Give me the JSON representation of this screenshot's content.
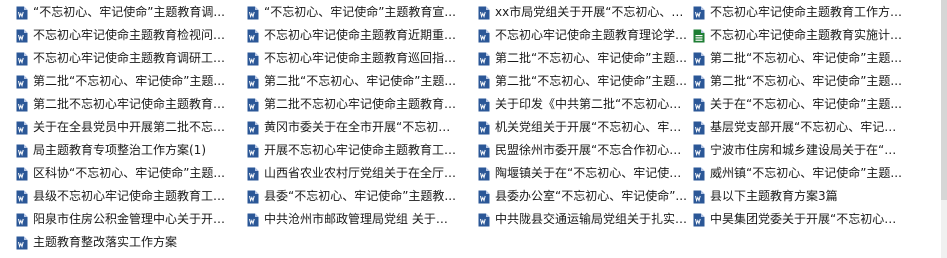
{
  "colors": {
    "doc_icon": "#2b5797",
    "doc_icon_fold": "#ffffff",
    "sheet_icon": "#1e7e34"
  },
  "files": [
    {
      "name": "“不忘初心、牢记使命”主题教育调...",
      "icon": "word-doc-icon"
    },
    {
      "name": "“不忘初心、牢记使命”主题教育宣...",
      "icon": "word-doc-icon"
    },
    {
      "name": "xx市局党组关于开展“不忘初心、牢...",
      "icon": "word-doc-icon"
    },
    {
      "name": "不忘初心牢记使命主题教育工作方案...",
      "icon": "word-doc-icon"
    },
    {
      "name": "不忘初心牢记使命主题教育检视问题...",
      "icon": "word-doc-icon"
    },
    {
      "name": "不忘初心牢记使命主题教育近期重点...",
      "icon": "word-doc-icon"
    },
    {
      "name": "不忘初心牢记使命主题教育理论学习...",
      "icon": "word-doc-icon"
    },
    {
      "name": "不忘初心牢记使命主题教育实施计划...",
      "icon": "spreadsheet-icon"
    },
    {
      "name": "不忘初心牢记使命主题教育调研工作...",
      "icon": "word-doc-icon"
    },
    {
      "name": "不忘初心牢记使命主题教育巡回指导...",
      "icon": "word-doc-icon"
    },
    {
      "name": "第二批“不忘初心、牢记使命”主题...",
      "icon": "word-doc-icon"
    },
    {
      "name": "第二批“不忘初心、牢记使命”主题...",
      "icon": "word-doc-icon"
    },
    {
      "name": "第二批“不忘初心、牢记使命”主题...",
      "icon": "word-doc-icon"
    },
    {
      "name": "第二批“不忘初心、牢记使命”主题...",
      "icon": "word-doc-icon"
    },
    {
      "name": "第二批“不忘初心、牢记使命”主题...",
      "icon": "word-doc-icon"
    },
    {
      "name": "第二批“不忘初心、牢记使命”主题...",
      "icon": "word-doc-icon"
    },
    {
      "name": "第二批不忘初心牢记使命主题教育调...",
      "icon": "word-doc-icon"
    },
    {
      "name": "第二批不忘初心牢记使命主题教育巡...",
      "icon": "word-doc-icon"
    },
    {
      "name": "关于印发《中共第二批“不忘初心、...",
      "icon": "word-doc-icon"
    },
    {
      "name": "关于在“不忘初心、牢记使命”主题...",
      "icon": "word-doc-icon"
    },
    {
      "name": "关于在全县党员中开展第二批不忘初...",
      "icon": "word-doc-icon"
    },
    {
      "name": "黄冈市委关于在全市开展“不忘初心...",
      "icon": "word-doc-icon"
    },
    {
      "name": "机关党组关于开展“不忘初心、牢记...",
      "icon": "word-doc-icon"
    },
    {
      "name": "基层党支部开展“不忘初心、牢记使...",
      "icon": "word-doc-icon"
    },
    {
      "name": "局主题教育专项整治工作方案(1)",
      "icon": "word-doc-icon"
    },
    {
      "name": "开展不忘初心牢记使命主题教育工作...",
      "icon": "word-doc-icon"
    },
    {
      "name": "民盟徐州市委开展“不忘合作初心，...",
      "icon": "word-doc-icon"
    },
    {
      "name": "宁波市住房和城乡建设局关于在“不...",
      "icon": "word-doc-icon"
    },
    {
      "name": "区科协“不忘初心、牢记使命”主题...",
      "icon": "word-doc-icon"
    },
    {
      "name": "山西省农业农村厅党组关于在全厅开...",
      "icon": "word-doc-icon"
    },
    {
      "name": "陶堰镇关于在“不忘初心、牢记使命...",
      "icon": "word-doc-icon"
    },
    {
      "name": "威州镇“不忘初心、牢记使命”主题...",
      "icon": "word-doc-icon"
    },
    {
      "name": "县级不忘初心牢记使命主题教育工作...",
      "icon": "word-doc-icon"
    },
    {
      "name": "县委“不忘初心、牢记使命”主题教...",
      "icon": "word-doc-icon"
    },
    {
      "name": "县委办公室“不忘初心、牢记使命”...",
      "icon": "word-doc-icon"
    },
    {
      "name": "县以下主题教育方案3篇",
      "icon": "word-doc-icon"
    },
    {
      "name": "阳泉市住房公积金管理中心关于开展...",
      "icon": "word-doc-icon"
    },
    {
      "name": "中共沧州市邮政管理局党组 关于深...",
      "icon": "word-doc-icon"
    },
    {
      "name": "中共陇县交通运输局党组关于扎实开...",
      "icon": "word-doc-icon"
    },
    {
      "name": "中昊集团党委关于开展“不忘初心、...",
      "icon": "word-doc-icon"
    },
    {
      "name": "主题教育整改落实工作方案",
      "icon": "word-doc-icon"
    }
  ]
}
